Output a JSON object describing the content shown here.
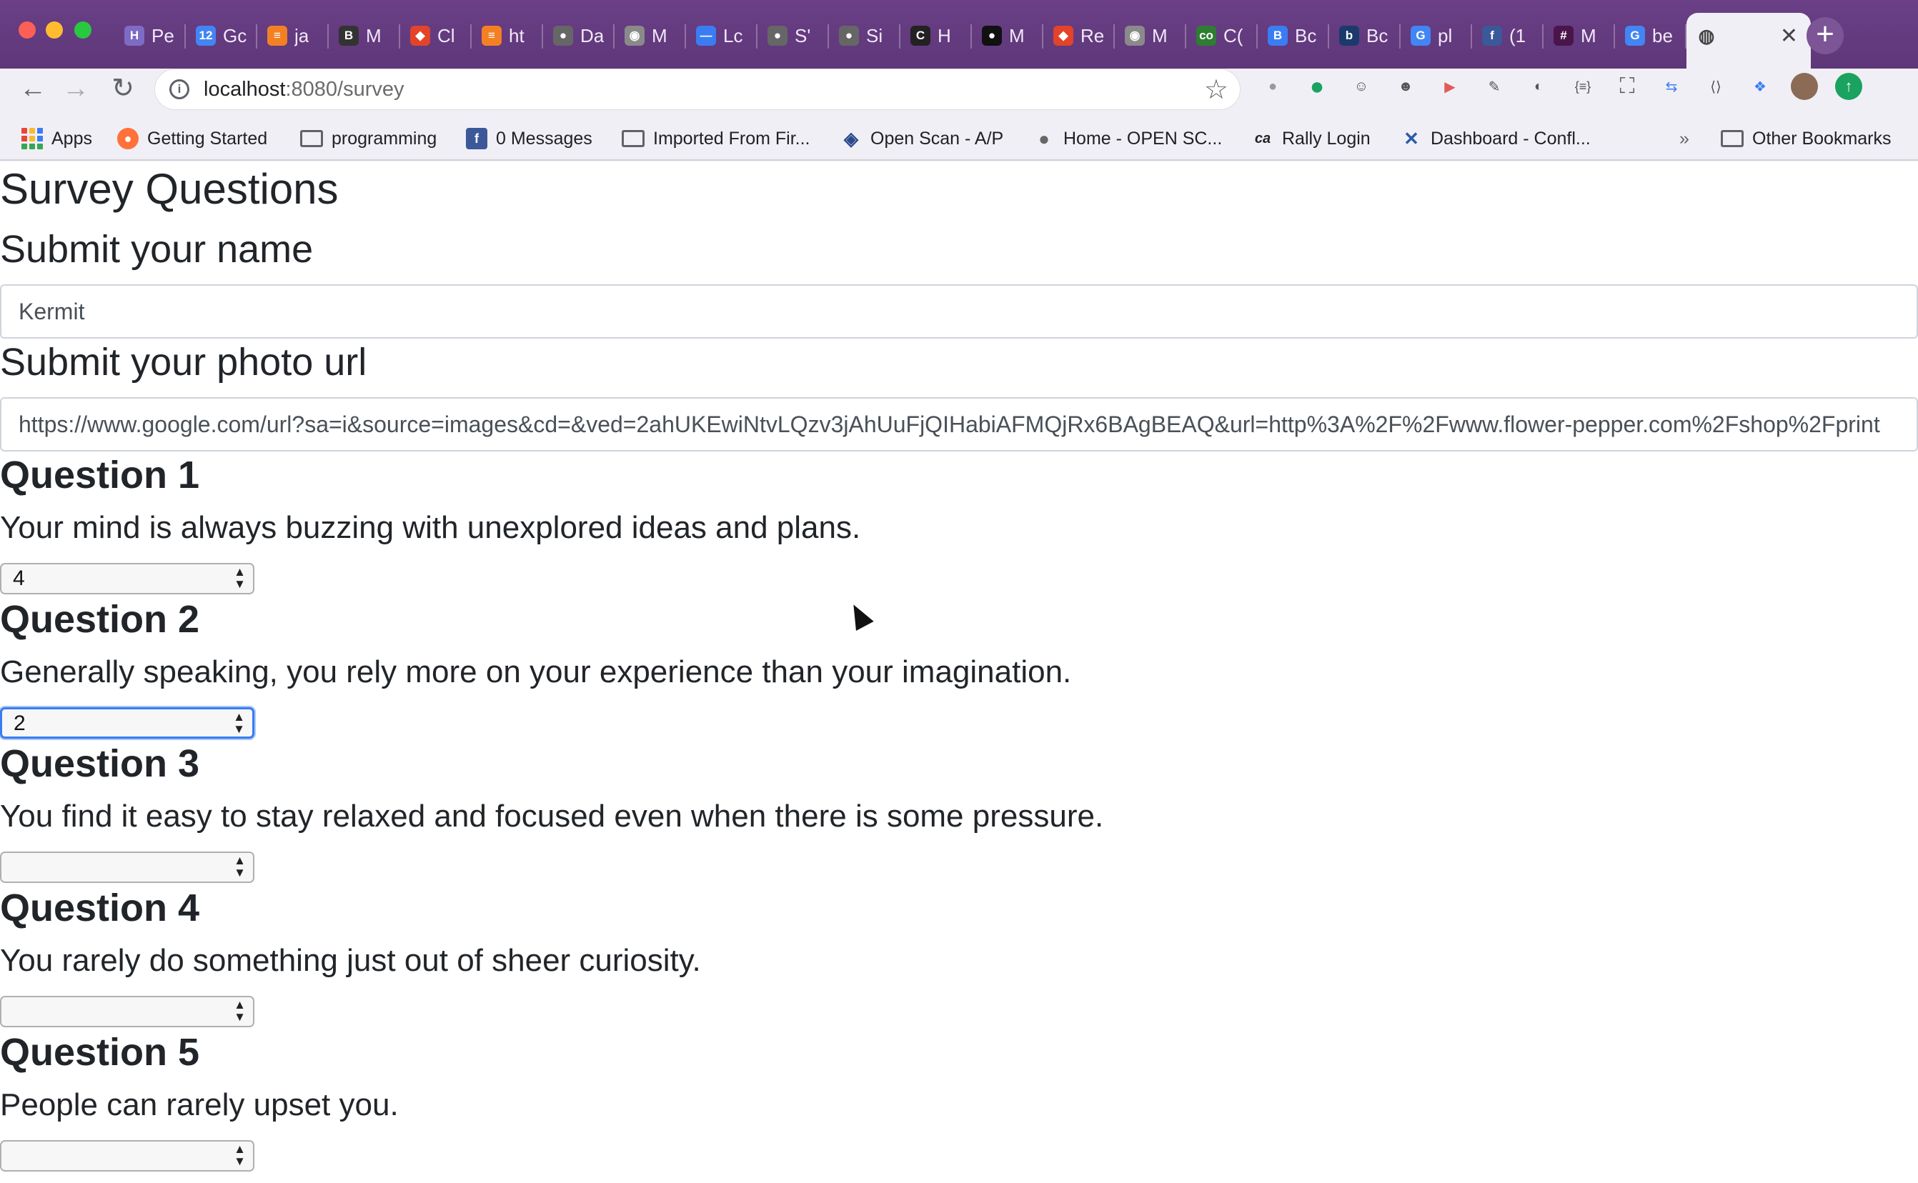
{
  "browser": {
    "tabs": [
      {
        "label": "Pe",
        "icon": "h-icon",
        "color": "#7e6bc4",
        "glyph": "H"
      },
      {
        "label": "Gc",
        "icon": "calendar-icon",
        "color": "#4285f4",
        "glyph": "12"
      },
      {
        "label": "ja",
        "icon": "stackoverflow-icon",
        "color": "#f48024",
        "glyph": "≡"
      },
      {
        "label": "M",
        "icon": "bold-b-icon",
        "color": "#333333",
        "glyph": "B"
      },
      {
        "label": "Cl",
        "icon": "gitlab-icon",
        "color": "#e24329",
        "glyph": "◆"
      },
      {
        "label": "ht",
        "icon": "stackoverflow-icon",
        "color": "#f48024",
        "glyph": "≡"
      },
      {
        "label": "Da",
        "icon": "globe-icon",
        "color": "#666666",
        "glyph": "●"
      },
      {
        "label": "M",
        "icon": "elephant-icon",
        "color": "#8a8a8a",
        "glyph": "◉"
      },
      {
        "label": "Lc",
        "icon": "dash-icon",
        "color": "#3a7df3",
        "glyph": "—"
      },
      {
        "label": "S'",
        "icon": "globe-icon",
        "color": "#666666",
        "glyph": "●"
      },
      {
        "label": "Si",
        "icon": "globe-icon",
        "color": "#666666",
        "glyph": "●"
      },
      {
        "label": "H",
        "icon": "c-icon",
        "color": "#222222",
        "glyph": "C"
      },
      {
        "label": "M",
        "icon": "github-icon",
        "color": "#111111",
        "glyph": "●"
      },
      {
        "label": "Re",
        "icon": "gitlab-icon",
        "color": "#e24329",
        "glyph": "◆"
      },
      {
        "label": "M",
        "icon": "elephant-icon",
        "color": "#8a8a8a",
        "glyph": "◉"
      },
      {
        "label": "C(",
        "icon": "co-icon",
        "color": "#2e7d32",
        "glyph": "co"
      },
      {
        "label": "Bc",
        "icon": "b-icon",
        "color": "#3a7df3",
        "glyph": "B"
      },
      {
        "label": "Bc",
        "icon": "b-icon",
        "color": "#1b3a6b",
        "glyph": "b"
      },
      {
        "label": "pl",
        "icon": "google-icon",
        "color": "#4285f4",
        "glyph": "G"
      },
      {
        "label": "(1",
        "icon": "facebook-icon",
        "color": "#3b5998",
        "glyph": "f"
      },
      {
        "label": "M",
        "icon": "slack-icon",
        "color": "#4a154b",
        "glyph": "#"
      },
      {
        "label": "be",
        "icon": "google-icon",
        "color": "#4285f4",
        "glyph": "G"
      }
    ],
    "url_host": "localhost",
    "url_path": ":8080/survey",
    "bookmarks": [
      {
        "label": "Apps",
        "icon": "apps-grid-icon"
      },
      {
        "label": "Getting Started",
        "icon": "firefox-icon"
      },
      {
        "label": "programming",
        "icon": "folder-icon"
      },
      {
        "label": "0 Messages",
        "icon": "facebook-icon"
      },
      {
        "label": "Imported From Fir...",
        "icon": "folder-icon"
      },
      {
        "label": "Open Scan - A/P",
        "icon": "scan-icon"
      },
      {
        "label": "Home - OPEN SC...",
        "icon": "globe-icon"
      },
      {
        "label": "Rally Login",
        "icon": "ca-icon"
      },
      {
        "label": "Dashboard - Confl...",
        "icon": "confluence-icon"
      },
      {
        "label": "»",
        "icon": "overflow-chevron-icon"
      },
      {
        "label": "Other Bookmarks",
        "icon": "folder-icon"
      }
    ]
  },
  "page": {
    "title": "Survey Questions",
    "name_heading": "Submit your name",
    "name_value": "Kermit",
    "photo_heading": "Submit your photo url",
    "photo_value": "https://www.google.com/url?sa=i&source=images&cd=&ved=2ahUKEwiNtvLQzv3jAhUuFjQIHabiAFMQjRx6BAgBEAQ&url=http%3A%2F%2Fwww.flower-pepper.com%2Fshop%2Fprint",
    "questions": [
      {
        "title": "Question 1",
        "text": "Your mind is always buzzing with unexplored ideas and plans.",
        "answer": "4"
      },
      {
        "title": "Question 2",
        "text": "Generally speaking, you rely more on your experience than your imagination.",
        "answer": "2"
      },
      {
        "title": "Question 3",
        "text": "You find it easy to stay relaxed and focused even when there is some pressure.",
        "answer": ""
      },
      {
        "title": "Question 4",
        "text": "You rarely do something just out of sheer curiosity.",
        "answer": ""
      },
      {
        "title": "Question 5",
        "text": "People can rarely upset you.",
        "answer": ""
      }
    ]
  }
}
